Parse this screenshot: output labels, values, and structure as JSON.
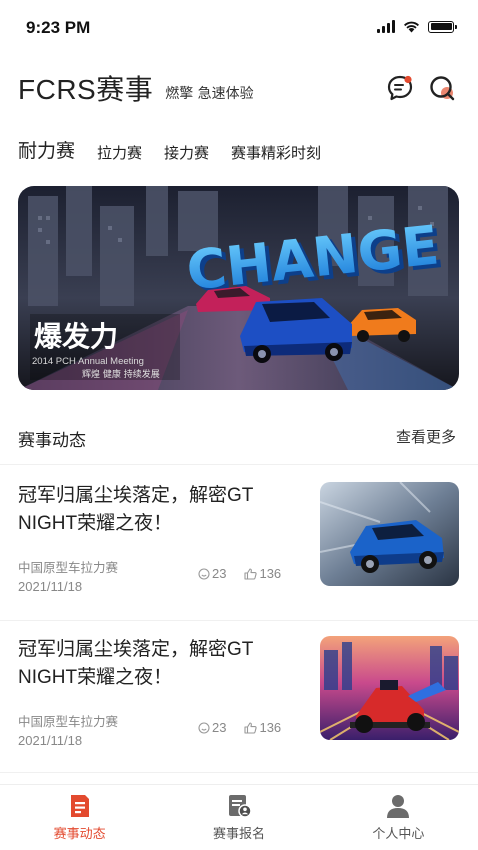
{
  "status_bar": {
    "time": "9:23 PM"
  },
  "header": {
    "title": "FCRS赛事",
    "slogan": "燃擎 急速体验",
    "icons": [
      "message-icon",
      "search-icon"
    ],
    "accent_color": "#e34a2f"
  },
  "tabs": [
    {
      "label": "耐力赛",
      "active": true
    },
    {
      "label": "拉力赛",
      "active": false
    },
    {
      "label": "接力赛",
      "active": false
    },
    {
      "label": "赛事精彩时刻",
      "active": false
    }
  ],
  "banner": {
    "headline": "CHANGE",
    "overlay_title": "爆发力",
    "overlay_sub": "2014 PCH Annual Meeting",
    "overlay_tag": "辉煌 健康 持续发展"
  },
  "section": {
    "title": "赛事动态",
    "more": "查看更多"
  },
  "news": [
    {
      "title": "冠军归属尘埃落定，解密GT NIGHT荣耀之夜！",
      "category": "中国原型车拉力赛",
      "date": "2021/11/18",
      "comments": "23",
      "likes": "136",
      "thumbnail": "blue-sports-car-image"
    },
    {
      "title": "冠军归属尘埃落定，解密GT NIGHT荣耀之夜！",
      "category": "中国原型车拉力赛",
      "date": "2021/11/18",
      "comments": "23",
      "likes": "136",
      "thumbnail": "formula-race-car-illustration"
    }
  ],
  "bottom_nav": [
    {
      "label": "赛事动态",
      "icon": "news-icon",
      "active": true
    },
    {
      "label": "赛事报名",
      "icon": "registration-icon",
      "active": false
    },
    {
      "label": "个人中心",
      "icon": "profile-icon",
      "active": false
    }
  ]
}
